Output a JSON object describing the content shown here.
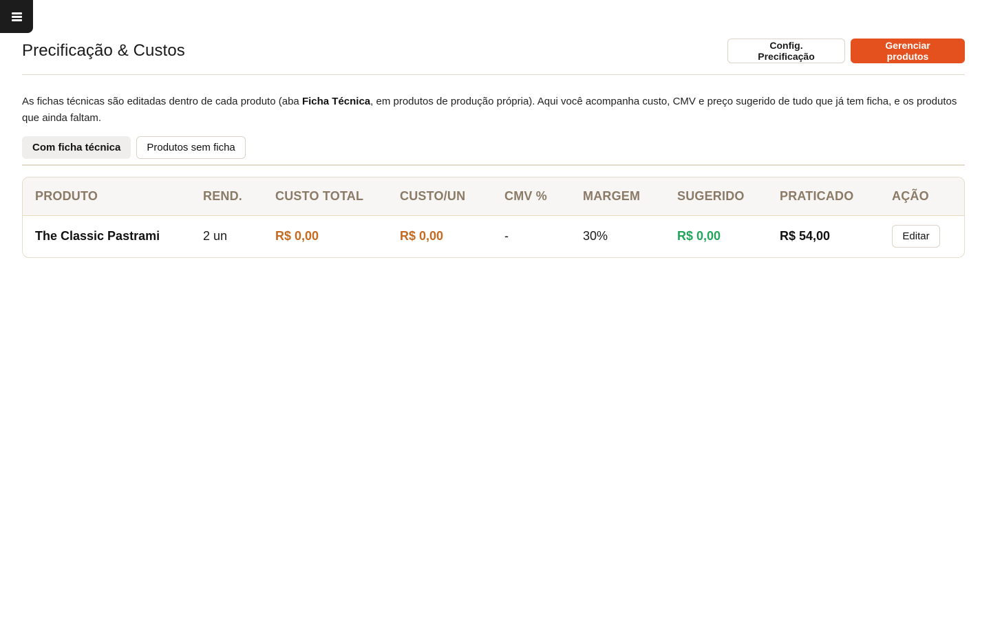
{
  "menu": {
    "icon": "hamburger-menu-icon"
  },
  "header": {
    "title": "Precificação & Custos",
    "config_button": "Config. Precificação",
    "manage_button": "Gerenciar produtos"
  },
  "description": {
    "part1": "As fichas técnicas são editadas dentro de cada produto (aba ",
    "bold": "Ficha Técnica",
    "part2": ", em produtos de produção própria). Aqui você acompanha custo, CMV e preço sugerido de tudo que já tem ficha, e os produtos que ainda faltam."
  },
  "tabs": [
    {
      "label": "Com ficha técnica",
      "active": true
    },
    {
      "label": "Produtos sem ficha",
      "active": false
    }
  ],
  "table": {
    "columns": [
      "PRODUTO",
      "REND.",
      "CUSTO TOTAL",
      "CUSTO/UN",
      "CMV %",
      "MARGEM",
      "SUGERIDO",
      "PRATICADO",
      "AÇÃO"
    ],
    "rows": [
      {
        "produto": "The Classic Pastrami",
        "rend": "2 un",
        "custo_total": "R$ 0,00",
        "custo_un": "R$ 0,00",
        "cmv": "-",
        "margem": "30%",
        "sugerido": "R$ 0,00",
        "praticado": "R$ 54,00",
        "acao": "Editar"
      }
    ]
  },
  "colors": {
    "primary": "#e4511e",
    "cost": "#c56a1f",
    "suggested": "#22a55a",
    "header_text": "#8a7a66"
  }
}
